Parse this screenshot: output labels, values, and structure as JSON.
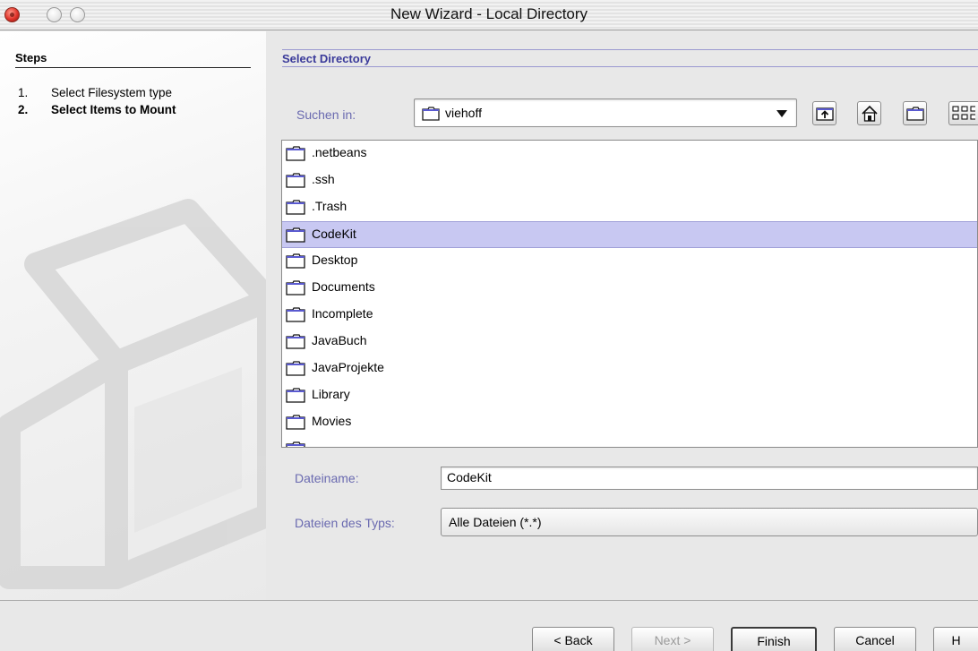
{
  "window": {
    "title": "New Wizard - Local Directory"
  },
  "steps": {
    "heading": "Steps",
    "items": [
      {
        "num": "1.",
        "label": "Select Filesystem type",
        "active": false
      },
      {
        "num": "2.",
        "label": "Select Items to Mount",
        "active": true
      }
    ]
  },
  "main": {
    "section_title": "Select Directory",
    "look_in_label": "Suchen in:",
    "look_in_value": "viehoff",
    "toolbar": [
      "up-folder-icon",
      "home-icon",
      "new-folder-icon",
      "list-view-icon"
    ],
    "files": [
      ".netbeans",
      ".ssh",
      ".Trash",
      "CodeKit",
      "Desktop",
      "Documents",
      "Incomplete",
      "JavaBuch",
      "JavaProjekte",
      "Library",
      "Movies"
    ],
    "selected_file": "CodeKit",
    "filename_label": "Dateiname:",
    "filename_value": "CodeKit",
    "filetype_label": "Dateien des Typs:",
    "filetype_value": "Alle Dateien (*.*)"
  },
  "buttons": {
    "back": "< Back",
    "next": "Next >",
    "finish": "Finish",
    "cancel": "Cancel",
    "help": "H"
  },
  "colors": {
    "selection": "#c8c8f2",
    "section_title": "#3a3a9a",
    "muted_label": "#6a6ab0"
  }
}
